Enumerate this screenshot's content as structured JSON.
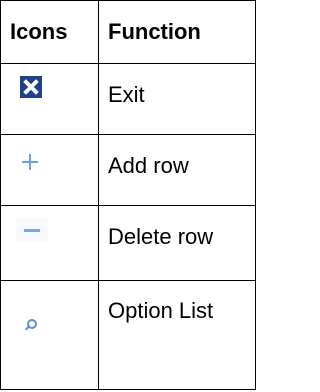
{
  "table": {
    "headers": {
      "icons": "Icons",
      "function": "Function"
    },
    "rows": [
      {
        "icon": "exit-icon",
        "function": "Exit"
      },
      {
        "icon": "add-icon",
        "function": "Add row"
      },
      {
        "icon": "minus-icon",
        "function": "Delete row"
      },
      {
        "icon": "search-icon",
        "function": "Option List"
      }
    ]
  },
  "colors": {
    "exit_icon_bg": "#1f3f8f",
    "icon_blue": "#6aa2e3"
  }
}
